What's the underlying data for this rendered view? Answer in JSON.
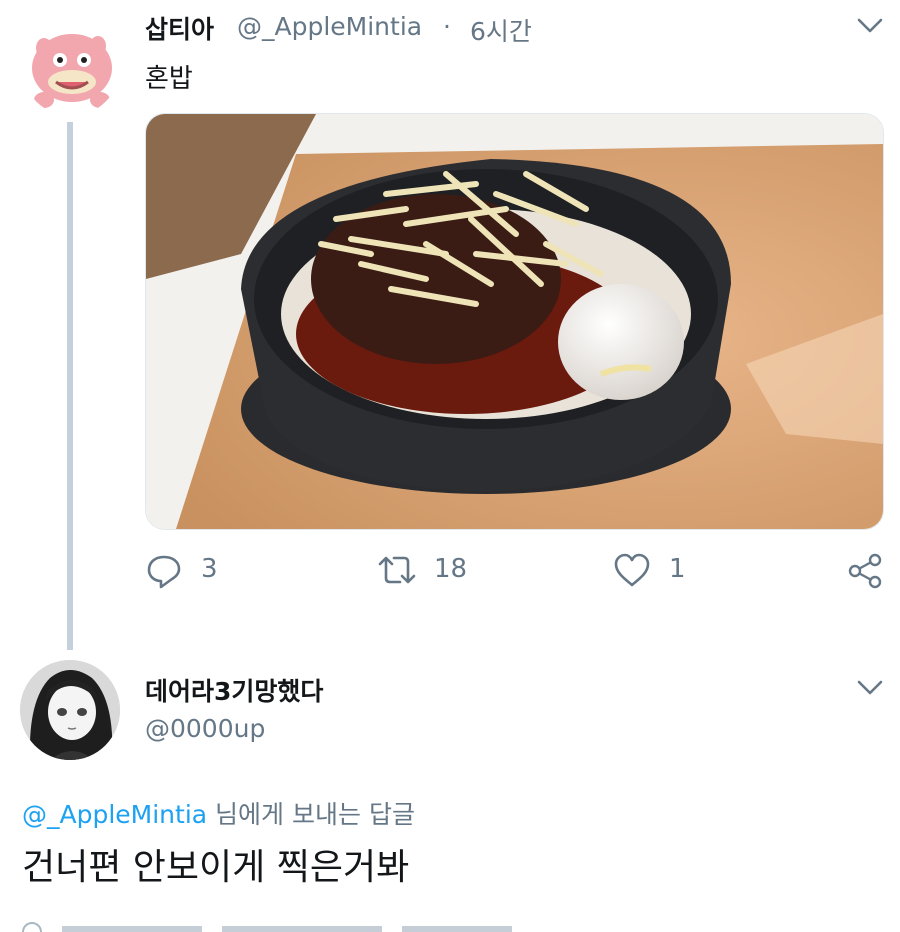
{
  "tweet1": {
    "display_name": "삽티아",
    "handle": "@_AppleMintia",
    "separator": "·",
    "time": "6시간",
    "text": "혼밥",
    "actions": {
      "replies": "3",
      "retweets": "18",
      "likes": "1"
    }
  },
  "tweet2": {
    "display_name": "데어라3기망했다",
    "handle": "@0000up",
    "reply_to_mention": "@_AppleMintia",
    "reply_to_suffix": " 님에게 보내는 답글",
    "text": "건너편 안보이게 찍은거봐"
  },
  "colors": {
    "text": "#14171a",
    "secondary": "#657786",
    "link": "#1da1f2",
    "thread_line": "#c4d1dc",
    "avatar_pink": "#f1a7ad"
  },
  "icons": [
    "chevron-down-icon",
    "reply-icon",
    "retweet-icon",
    "heart-icon",
    "share-icon"
  ]
}
